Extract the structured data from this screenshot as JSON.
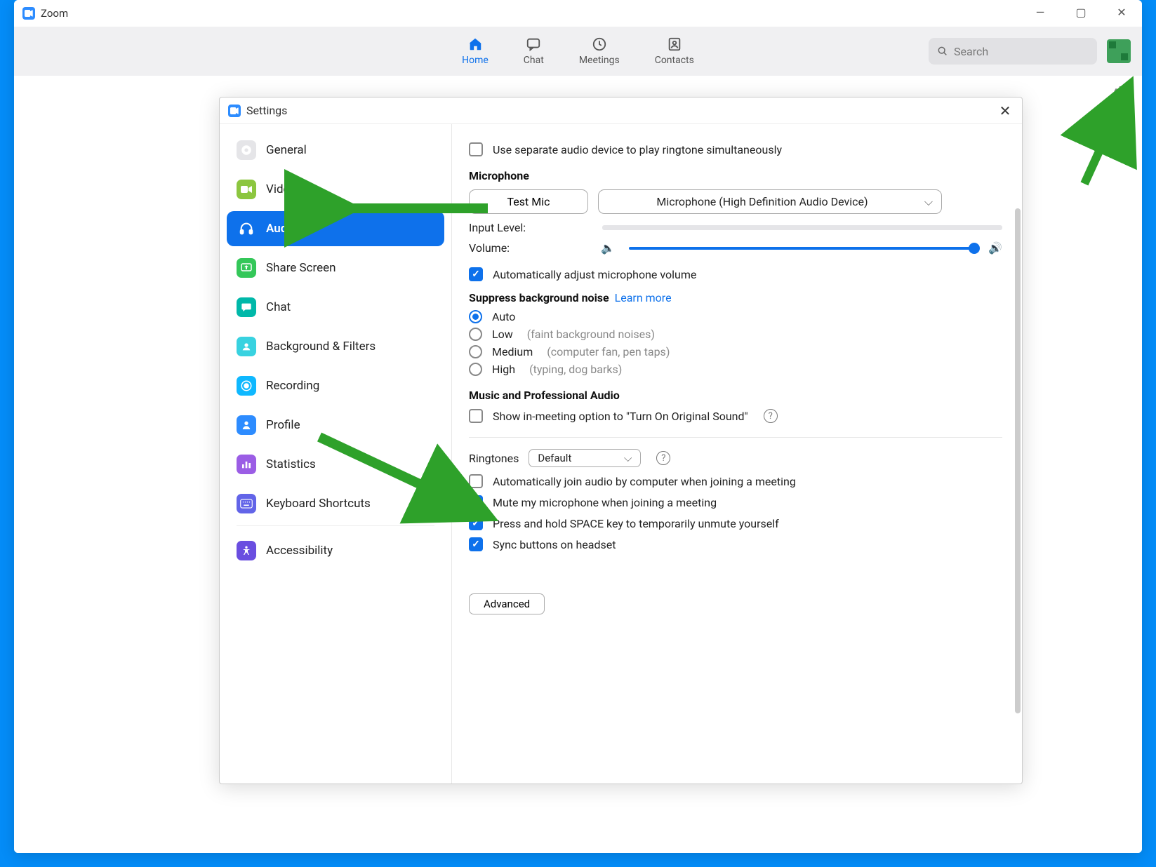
{
  "window": {
    "title": "Zoom"
  },
  "tabs": {
    "home": "Home",
    "chat": "Chat",
    "meetings": "Meetings",
    "contacts": "Contacts"
  },
  "search": {
    "placeholder": "Search"
  },
  "settings": {
    "title": "Settings",
    "nav": [
      {
        "id": "general",
        "label": "General"
      },
      {
        "id": "video",
        "label": "Video"
      },
      {
        "id": "audio",
        "label": "Audio",
        "active": true
      },
      {
        "id": "share-screen",
        "label": "Share Screen"
      },
      {
        "id": "chat",
        "label": "Chat"
      },
      {
        "id": "background-filters",
        "label": "Background & Filters"
      },
      {
        "id": "recording",
        "label": "Recording"
      },
      {
        "id": "profile",
        "label": "Profile"
      },
      {
        "id": "statistics",
        "label": "Statistics"
      },
      {
        "id": "keyboard-shortcuts",
        "label": "Keyboard Shortcuts"
      },
      {
        "id": "accessibility",
        "label": "Accessibility"
      }
    ],
    "audio": {
      "separate_ringtone": "Use separate audio device to play ringtone simultaneously",
      "mic_header": "Microphone",
      "test_mic": "Test Mic",
      "mic_device": "Microphone (High Definition Audio Device)",
      "input_level": "Input Level:",
      "volume": "Volume:",
      "auto_adjust": "Automatically adjust microphone volume",
      "suppress_header": "Suppress background noise",
      "learn_more": "Learn more",
      "suppress_options": [
        {
          "label": "Auto",
          "hint": "",
          "selected": true
        },
        {
          "label": "Low",
          "hint": "(faint background noises)"
        },
        {
          "label": "Medium",
          "hint": "(computer fan, pen taps)"
        },
        {
          "label": "High",
          "hint": "(typing, dog barks)"
        }
      ],
      "music_header": "Music and Professional Audio",
      "original_sound": "Show in-meeting option to \"Turn On Original Sound\"",
      "ringtones_label": "Ringtones",
      "ringtones_value": "Default",
      "auto_join": "Automatically join audio by computer when joining a meeting",
      "mute_on_join": "Mute my microphone when joining a meeting",
      "space_unmute": "Press and hold SPACE key to temporarily unmute yourself",
      "sync_headset": "Sync buttons on headset",
      "advanced": "Advanced"
    }
  }
}
